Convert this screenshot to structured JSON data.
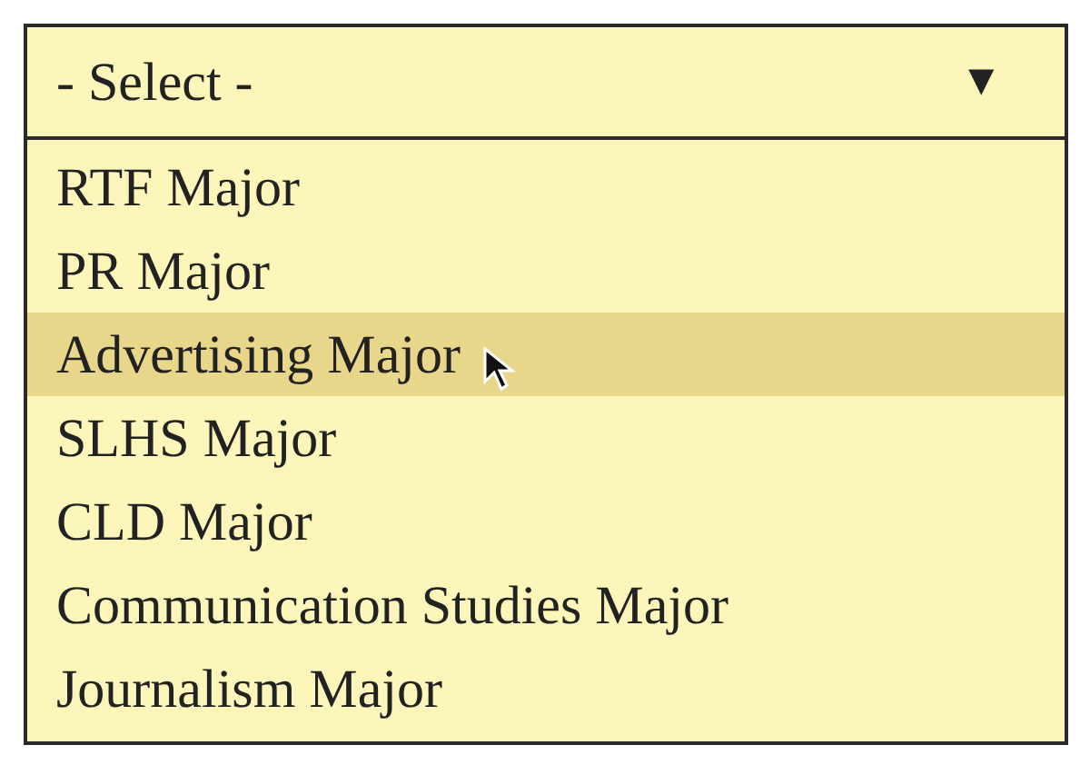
{
  "select": {
    "value": "- Select -",
    "arrow": "▼"
  },
  "options": [
    {
      "label": "RTF Major",
      "selected": false
    },
    {
      "label": "PR Major",
      "selected": false
    },
    {
      "label": "Advertising Major",
      "selected": true
    },
    {
      "label": "SLHS Major",
      "selected": false
    },
    {
      "label": "CLD Major",
      "selected": false
    },
    {
      "label": "Communication Studies Major",
      "selected": false
    },
    {
      "label": "Journalism Major",
      "selected": false
    }
  ]
}
